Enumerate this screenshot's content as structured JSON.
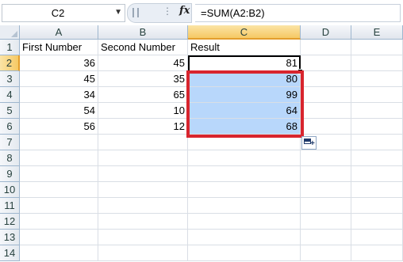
{
  "formula_bar": {
    "name_box": "C2",
    "name_box_arrow": "▼",
    "fx_label": "fx",
    "formula": "=SUM(A2:B2)"
  },
  "columns": [
    "A",
    "B",
    "C",
    "D",
    "E"
  ],
  "selected_column": "C",
  "rows": [
    "1",
    "2",
    "3",
    "4",
    "5",
    "6",
    "7",
    "8",
    "9",
    "10",
    "11",
    "12",
    "13",
    "14"
  ],
  "selected_row": "2",
  "headers": {
    "a": "First Number",
    "b": "Second Number",
    "c": "Result"
  },
  "data": [
    {
      "a": "36",
      "b": "45",
      "c": "81"
    },
    {
      "a": "45",
      "b": "35",
      "c": "80"
    },
    {
      "a": "34",
      "b": "65",
      "c": "99"
    },
    {
      "a": "54",
      "b": "10",
      "c": "64"
    },
    {
      "a": "56",
      "b": "12",
      "c": "68"
    }
  ],
  "colors": {
    "selection_fill": "#b8d7fb",
    "annotation_border": "#d8252e",
    "active_header": "#f6c964"
  },
  "icons": {
    "auto_fill_options": "auto-fill-options-icon"
  }
}
